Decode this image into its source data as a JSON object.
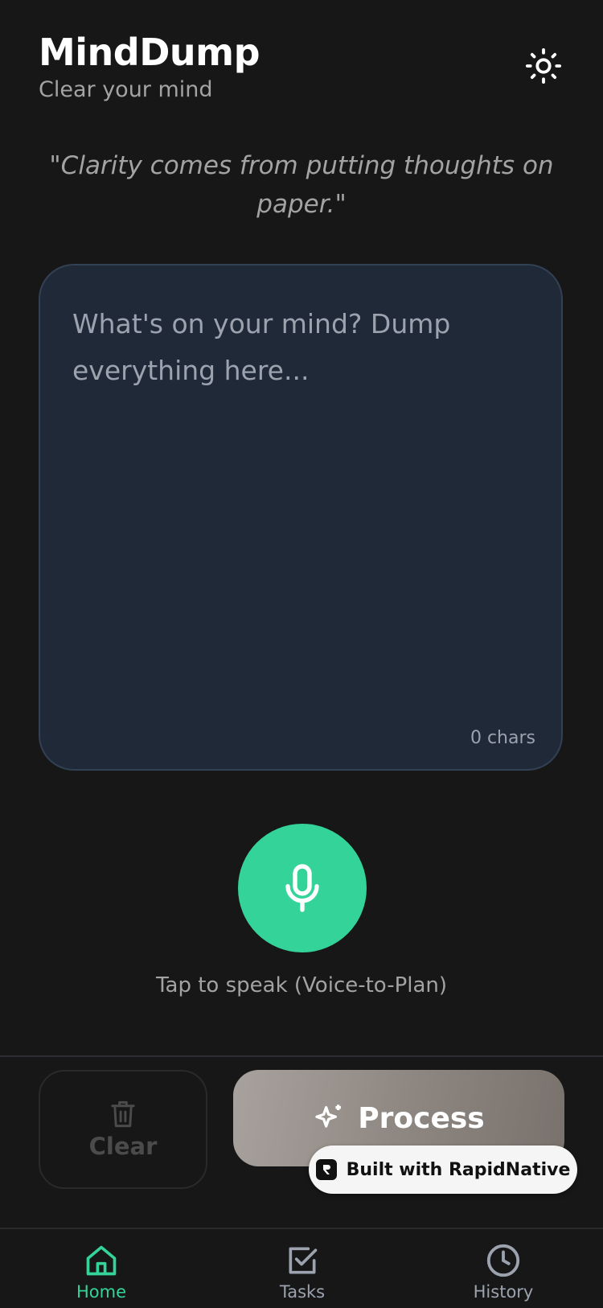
{
  "header": {
    "title": "MindDump",
    "subtitle": "Clear your mind",
    "theme_icon": "sun-icon"
  },
  "quote": "\"Clarity comes from putting thoughts on paper.\"",
  "editor": {
    "placeholder": "What's on your mind? Dump everything here...",
    "value": "",
    "char_count": "0 chars"
  },
  "voice": {
    "icon": "microphone-icon",
    "caption": "Tap to speak (Voice-to-Plan)"
  },
  "actions": {
    "clear_label": "Clear",
    "clear_icon": "trash-icon",
    "process_label": "Process",
    "process_icon": "sparkles-icon"
  },
  "badge": {
    "label": "Built with RapidNative"
  },
  "tabs": [
    {
      "label": "Home",
      "icon": "home-icon",
      "active": true
    },
    {
      "label": "Tasks",
      "icon": "checkbox-icon",
      "active": false
    },
    {
      "label": "History",
      "icon": "clock-icon",
      "active": false
    }
  ],
  "colors": {
    "background": "#171717",
    "accent": "#34d399",
    "editor_bg": "#1f2937",
    "muted_text": "#a3a3a3",
    "inactive_tab": "#9ca3af"
  }
}
